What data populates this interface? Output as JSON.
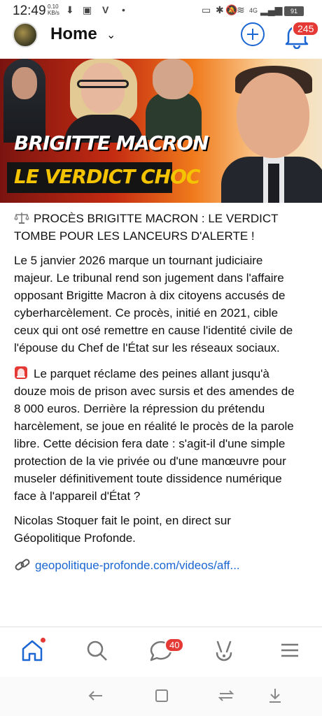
{
  "status_bar": {
    "time": "12:49",
    "net_speed_value": "0.10",
    "net_speed_unit": "KB/s",
    "signal_label": "4G",
    "battery": "91"
  },
  "header": {
    "title": "Home",
    "notification_count": "245",
    "accent": "#1a66d2"
  },
  "hero": {
    "line1": "BRIGITTE MACRON",
    "line2": "LE VERDICT CHOC"
  },
  "post": {
    "headline": "PROCÈS BRIGITTE MACRON : LE VERDICT TOMBE POUR LES LANCEURS D'ALERTE !",
    "paragraph1": "Le 5 janvier 2026 marque un tournant judiciaire majeur. Le tribunal rend son jugement dans l'affaire opposant Brigitte Macron à dix citoyens accusés de cyberharcèlement. Ce procès, initié en 2021, cible ceux qui ont osé remettre en cause l'identité civile de l'épouse du Chef de l'État sur les réseaux sociaux.",
    "paragraph2": "Le parquet réclame des peines allant jusqu'à douze mois de prison avec sursis et des amendes de 8 000 euros. Derrière la répression du prétendu harcèlement, se joue en réalité le procès de la parole libre. Cette décision fera date : s'agit-il d'une simple protection de la vie privée ou d'une manœuvre pour museler définitivement toute dissidence numérique face à l'appareil d'État ?",
    "paragraph3": "Nicolas Stoquer fait le point, en direct sur Géopolitique Profonde.",
    "link": "geopolitique-profonde.com/videos/aff..."
  },
  "bottom_nav": {
    "chat_badge": "40",
    "items": [
      "home-icon",
      "search-icon",
      "chat-icon",
      "hand-icon",
      "menu-icon"
    ]
  },
  "system_nav": [
    "back-icon",
    "home-square-icon",
    "recents-icon",
    "down-arrow-icon"
  ]
}
